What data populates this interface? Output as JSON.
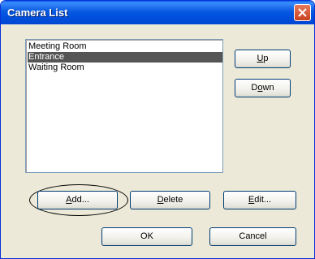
{
  "window": {
    "title": "Camera List"
  },
  "camera_list": {
    "items": [
      "Meeting Room",
      "Entrance",
      "Waiting Room"
    ],
    "selected_index": 1
  },
  "buttons": {
    "up": {
      "mnemonic": "U",
      "rest": "p"
    },
    "down": {
      "pre": "D",
      "mnemonic": "o",
      "rest": "wn"
    },
    "add": {
      "mnemonic": "A",
      "rest": "dd..."
    },
    "delete": {
      "mnemonic": "D",
      "rest": "elete"
    },
    "edit": {
      "mnemonic": "E",
      "rest": "dit..."
    },
    "ok": "OK",
    "cancel": "Cancel"
  },
  "colors": {
    "title_bar": "#0053e0",
    "selection": "#555555",
    "dialog_bg": "#ece9d8",
    "close_button": "#c8401e"
  }
}
